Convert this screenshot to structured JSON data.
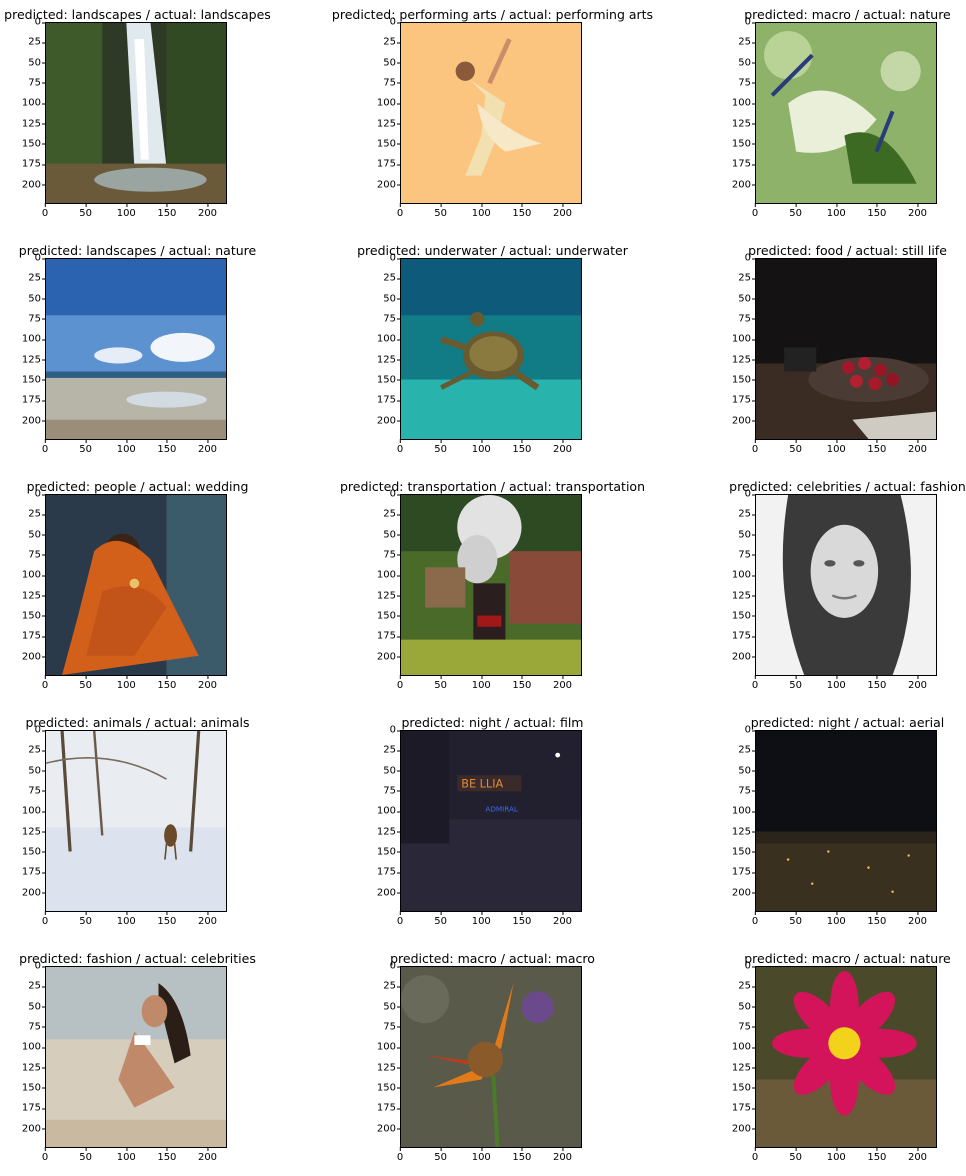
{
  "chart_data": [
    {
      "type": "image",
      "title": "predicted: landscapes / actual: landscapes",
      "scene": "waterfall",
      "x_ticks": [
        0,
        50,
        100,
        150,
        200
      ],
      "y_ticks": [
        0,
        25,
        50,
        75,
        100,
        125,
        150,
        175,
        200
      ],
      "xlim": [
        0,
        224
      ],
      "ylim": [
        224,
        0
      ]
    },
    {
      "type": "image",
      "title": "predicted: performing arts / actual: performing arts",
      "scene": "dancer",
      "x_ticks": [
        0,
        50,
        100,
        150,
        200
      ],
      "y_ticks": [
        0,
        25,
        50,
        75,
        100,
        125,
        150,
        175,
        200
      ],
      "xlim": [
        0,
        224
      ],
      "ylim": [
        224,
        0
      ]
    },
    {
      "type": "image",
      "title": "predicted: macro / actual: nature",
      "scene": "dragonfly",
      "x_ticks": [
        0,
        50,
        100,
        150,
        200
      ],
      "y_ticks": [
        0,
        25,
        50,
        75,
        100,
        125,
        150,
        175,
        200
      ],
      "xlim": [
        0,
        224
      ],
      "ylim": [
        224,
        0
      ]
    },
    {
      "type": "image",
      "title": "predicted: landscapes / actual: nature",
      "scene": "beach",
      "x_ticks": [
        0,
        50,
        100,
        150,
        200
      ],
      "y_ticks": [
        0,
        25,
        50,
        75,
        100,
        125,
        150,
        175,
        200
      ],
      "xlim": [
        0,
        224
      ],
      "ylim": [
        224,
        0
      ]
    },
    {
      "type": "image",
      "title": "predicted: underwater / actual: underwater",
      "scene": "turtle",
      "x_ticks": [
        0,
        50,
        100,
        150,
        200
      ],
      "y_ticks": [
        0,
        25,
        50,
        75,
        100,
        125,
        150,
        175,
        200
      ],
      "xlim": [
        0,
        224
      ],
      "ylim": [
        224,
        0
      ]
    },
    {
      "type": "image",
      "title": "predicted: food / actual: still life",
      "scene": "cherries",
      "x_ticks": [
        0,
        50,
        100,
        150,
        200
      ],
      "y_ticks": [
        0,
        25,
        50,
        75,
        100,
        125,
        150,
        175,
        200
      ],
      "xlim": [
        0,
        224
      ],
      "ylim": [
        224,
        0
      ]
    },
    {
      "type": "image",
      "title": "predicted: people / actual: wedding",
      "scene": "saree",
      "x_ticks": [
        0,
        50,
        100,
        150,
        200
      ],
      "y_ticks": [
        0,
        25,
        50,
        75,
        100,
        125,
        150,
        175,
        200
      ],
      "xlim": [
        0,
        224
      ],
      "ylim": [
        224,
        0
      ]
    },
    {
      "type": "image",
      "title": "predicted: transportation / actual: transportation",
      "scene": "train",
      "x_ticks": [
        0,
        50,
        100,
        150,
        200
      ],
      "y_ticks": [
        0,
        25,
        50,
        75,
        100,
        125,
        150,
        175,
        200
      ],
      "xlim": [
        0,
        224
      ],
      "ylim": [
        224,
        0
      ]
    },
    {
      "type": "image",
      "title": "predicted: celebrities / actual: fashion",
      "scene": "portrait",
      "x_ticks": [
        0,
        50,
        100,
        150,
        200
      ],
      "y_ticks": [
        0,
        25,
        50,
        75,
        100,
        125,
        150,
        175,
        200
      ],
      "xlim": [
        0,
        224
      ],
      "ylim": [
        224,
        0
      ]
    },
    {
      "type": "image",
      "title": "predicted: animals / actual: animals",
      "scene": "deer",
      "x_ticks": [
        0,
        50,
        100,
        150,
        200
      ],
      "y_ticks": [
        0,
        25,
        50,
        75,
        100,
        125,
        150,
        175,
        200
      ],
      "xlim": [
        0,
        224
      ],
      "ylim": [
        224,
        0
      ]
    },
    {
      "type": "image",
      "title": "predicted: night / actual: film",
      "scene": "neon",
      "x_ticks": [
        0,
        50,
        100,
        150,
        200
      ],
      "y_ticks": [
        0,
        25,
        50,
        75,
        100,
        125,
        150,
        175,
        200
      ],
      "xlim": [
        0,
        224
      ],
      "ylim": [
        224,
        0
      ]
    },
    {
      "type": "image",
      "title": "predicted: night / actual: aerial",
      "scene": "city",
      "x_ticks": [
        0,
        50,
        100,
        150,
        200
      ],
      "y_ticks": [
        0,
        25,
        50,
        75,
        100,
        125,
        150,
        175,
        200
      ],
      "xlim": [
        0,
        224
      ],
      "ylim": [
        224,
        0
      ]
    },
    {
      "type": "image",
      "title": "predicted: fashion / actual: celebrities",
      "scene": "beachmodel",
      "x_ticks": [
        0,
        50,
        100,
        150,
        200
      ],
      "y_ticks": [
        0,
        25,
        50,
        75,
        100,
        125,
        150,
        175,
        200
      ],
      "xlim": [
        0,
        224
      ],
      "ylim": [
        224,
        0
      ]
    },
    {
      "type": "image",
      "title": "predicted: macro / actual: macro",
      "scene": "redflower",
      "x_ticks": [
        0,
        50,
        100,
        150,
        200
      ],
      "y_ticks": [
        0,
        25,
        50,
        75,
        100,
        125,
        150,
        175,
        200
      ],
      "xlim": [
        0,
        224
      ],
      "ylim": [
        224,
        0
      ]
    },
    {
      "type": "image",
      "title": "predicted: macro / actual: nature",
      "scene": "cosmos",
      "x_ticks": [
        0,
        50,
        100,
        150,
        200
      ],
      "y_ticks": [
        0,
        25,
        50,
        75,
        100,
        125,
        150,
        175,
        200
      ],
      "xlim": [
        0,
        224
      ],
      "ylim": [
        224,
        0
      ]
    }
  ]
}
